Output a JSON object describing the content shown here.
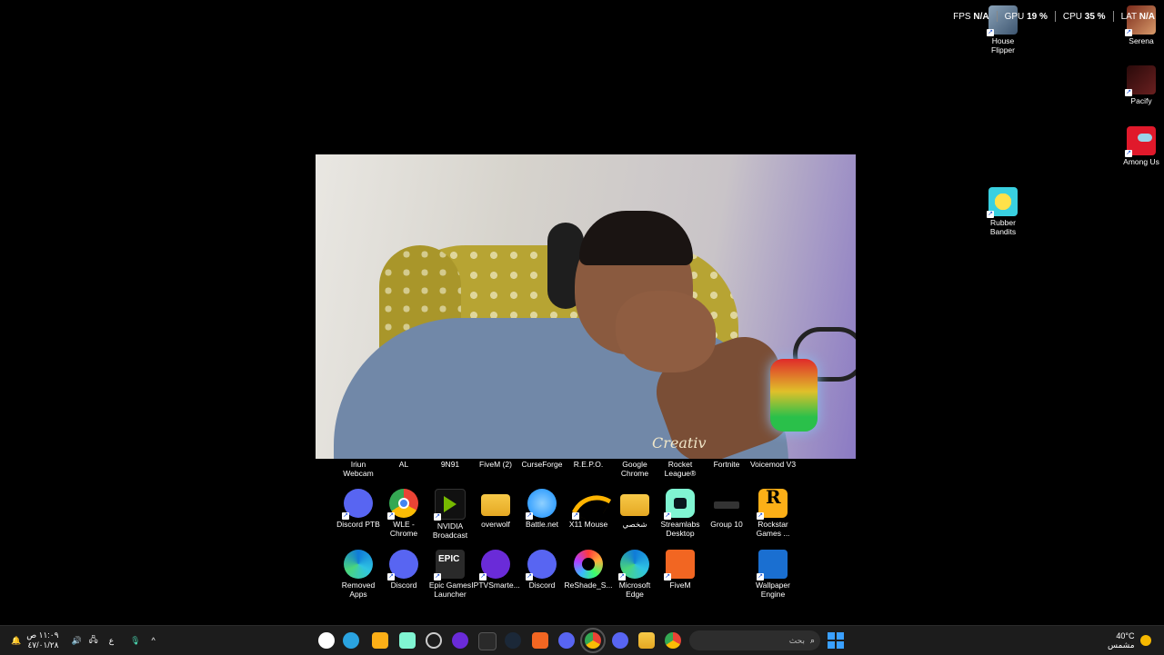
{
  "overlay": {
    "fps_label": "FPS",
    "fps_value": "N/A",
    "gpu_label": "GPU",
    "gpu_value": "19 %",
    "cpu_label": "CPU",
    "cpu_value": "35 %",
    "lat_label": "LAT",
    "lat_value": "N/A"
  },
  "right_icons": [
    {
      "label": "House\nFlipper"
    },
    {
      "label": "Serena"
    },
    {
      "label": "Pacify"
    },
    {
      "label": "Among Us"
    },
    {
      "label": "Rubber\nBandits"
    }
  ],
  "webcam": {
    "shirt_text": "Creativ"
  },
  "row1": [
    {
      "label": "Iriun\nWebcam"
    },
    {
      "label": "AL"
    },
    {
      "label": "9N91"
    },
    {
      "label": "FiveM (2)"
    },
    {
      "label": "CurseForge"
    },
    {
      "label": "R.E.P.O."
    },
    {
      "label": "Google\nChrome"
    },
    {
      "label": "Rocket\nLeague®"
    },
    {
      "label": "Fortnite"
    },
    {
      "label": "Voicemod V3"
    }
  ],
  "row2": [
    {
      "label": "Discord PTB",
      "icon": "discord-ptb-icon"
    },
    {
      "label": "WLE -\nChrome",
      "icon": "chrome-icon"
    },
    {
      "label": "NVIDIA\nBroadcast",
      "icon": "nvidia-broadcast-icon"
    },
    {
      "label": "overwolf",
      "icon": "folder-icon"
    },
    {
      "label": "Battle.net",
      "icon": "battlenet-icon"
    },
    {
      "label": "X11 Mouse",
      "icon": "x11-mouse-icon"
    },
    {
      "label": "شخصي",
      "icon": "folder-icon"
    },
    {
      "label": "Streamlabs\nDesktop",
      "icon": "streamlabs-icon"
    },
    {
      "label": "Group 10",
      "icon": "group-icon"
    },
    {
      "label": "Rockstar\nGames ...",
      "icon": "rockstar-icon"
    }
  ],
  "row3": [
    {
      "label": "Removed\nApps",
      "icon": "edge-icon"
    },
    {
      "label": "Discord",
      "icon": "discord-icon"
    },
    {
      "label": "Epic Games\nLauncher",
      "icon": "epic-games-icon"
    },
    {
      "label": "IPTVSmarte...",
      "icon": "iptv-icon"
    },
    {
      "label": "Discord",
      "icon": "discord-icon"
    },
    {
      "label": "ReShade_S...",
      "icon": "reshade-icon"
    },
    {
      "label": "Microsoft\nEdge",
      "icon": "edge-icon"
    },
    {
      "label": "FiveM",
      "icon": "fivem-icon"
    },
    {
      "label": "Wallpaper\nEngine",
      "icon": "wallpaper-engine-icon"
    }
  ],
  "taskbar": {
    "time": "١١:٠٩ ص",
    "date": "٤٧/٠١/٢٨",
    "lang": "ع",
    "search_placeholder": "بحث",
    "weather_temp": "40°C",
    "weather_desc": "مشمس"
  }
}
